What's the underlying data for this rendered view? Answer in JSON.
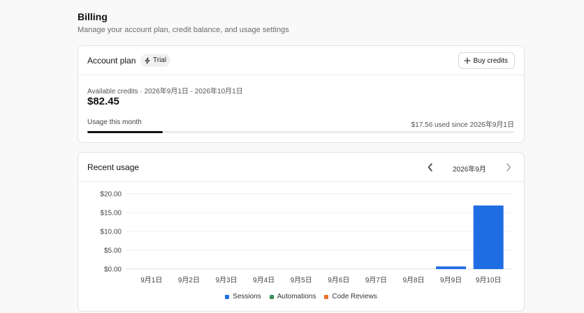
{
  "header": {
    "title": "Billing",
    "subtitle": "Manage your account plan, credit balance, and usage settings"
  },
  "plan": {
    "title": "Account plan",
    "badge": "Trial",
    "buy_button": "Buy credits",
    "credits_label": "Available credits · 2026年9月1日 - 2026年10月1日",
    "credits_amount": "$82.45",
    "usage_label": "Usage this month",
    "usage_used": "$17.56 used since 2026年9月1日",
    "usage_fraction": 0.176
  },
  "usage": {
    "title": "Recent usage",
    "month": "2026年9月",
    "prev_icon": "chevron-left-icon",
    "next_icon": "chevron-right-icon"
  },
  "colors": {
    "sessions": "#1f6de3",
    "automations": "#3a8f5a",
    "code_reviews": "#e5742b",
    "progress": "#111111"
  },
  "chart_data": {
    "type": "bar",
    "stacked": true,
    "categories": [
      "9月1日",
      "9月2日",
      "9月3日",
      "9月4日",
      "9月5日",
      "9月6日",
      "9月7日",
      "9月8日",
      "9月9日",
      "9月10日"
    ],
    "series": [
      {
        "name": "Sessions",
        "values": [
          0,
          0,
          0,
          0,
          0,
          0,
          0,
          0,
          0.7,
          16.9
        ]
      },
      {
        "name": "Automations",
        "values": [
          0,
          0,
          0,
          0,
          0,
          0,
          0,
          0,
          0,
          0
        ]
      },
      {
        "name": "Code Reviews",
        "values": [
          0,
          0,
          0,
          0,
          0,
          0,
          0,
          0,
          0,
          0
        ]
      }
    ],
    "yticks": [
      "$0.00",
      "$5.00",
      "$10.00",
      "$15.00",
      "$20.00"
    ],
    "ytick_values": [
      0,
      5,
      10,
      15,
      20
    ],
    "ylim": [
      0,
      20
    ],
    "grid": true,
    "legend": "bottom"
  }
}
